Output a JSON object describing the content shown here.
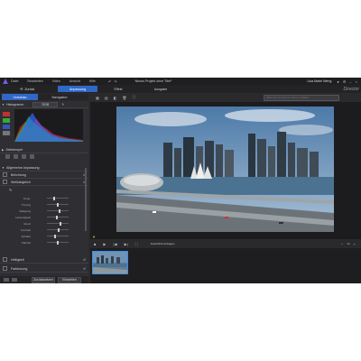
{
  "titlebar": {
    "menu": [
      "Datei",
      "Bearbeiten",
      "Video",
      "Ansicht",
      "Hilfe"
    ],
    "project_title": "Neues Projekt ohne Titel*",
    "user": "Lisa Marie Weng",
    "brand": "Director"
  },
  "toolbar": {
    "back_label": "Zurück",
    "tabs": [
      "Anpassung",
      "Effekt",
      "Ausgabe"
    ]
  },
  "side_tabs": [
    "Vorschau",
    "Navigation"
  ],
  "search": {
    "placeholder": "Millionen lizenzfreie Videos & Bilder"
  },
  "histogram": {
    "label": "Histogramm",
    "mode": "RGB"
  },
  "sections": {
    "zeitstempel": "Zeitstempel",
    "anpassung_global": "Allgemeine Anpassung",
    "belichtung": "Belichtung",
    "weissabgleich": "Weißabgleich",
    "helligkeit": "Helligkeit",
    "farbton": "Farbtonung"
  },
  "adjust_sliders": [
    {
      "label": "Temp.",
      "value": 0.3
    },
    {
      "label": "Tönung",
      "value": 0.45
    },
    {
      "label": "Sättigung",
      "value": 0.55
    },
    {
      "label": "Lebendigkeit",
      "value": 0.4
    },
    {
      "label": "Glanz",
      "value": 0.6
    },
    {
      "label": "Kontrast",
      "value": 0.5
    },
    {
      "label": "Schärfe",
      "value": 0.35
    },
    {
      "label": "Klarheit",
      "value": 0.45
    }
  ],
  "bottom_buttons": [
    "Zurücksetzen",
    "Einstellen"
  ],
  "timeline": {
    "timecode_label": "Ausschnitt anzeigen",
    "zoom_label": "1x"
  },
  "colors": {
    "accent": "#2f68c7",
    "bg": "#2b2b2e",
    "timeline_bg": "#1e1e21"
  }
}
